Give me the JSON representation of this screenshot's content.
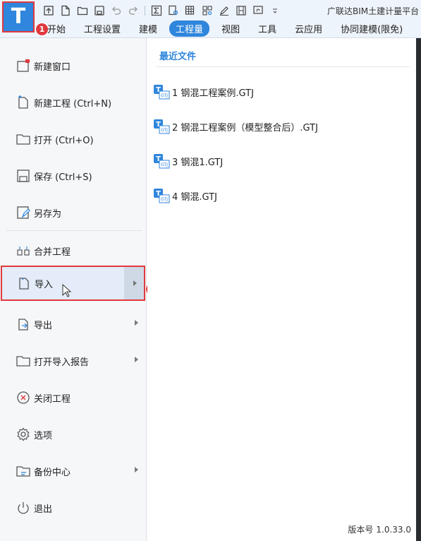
{
  "app": {
    "title": "广联达BIM土建计量平台",
    "logo_letter": "T"
  },
  "badges": {
    "first": "1",
    "second": "2"
  },
  "tabs": [
    {
      "label": "开始",
      "active": false
    },
    {
      "label": "工程设置",
      "active": false
    },
    {
      "label": "建模",
      "active": false
    },
    {
      "label": "工程量",
      "active": true
    },
    {
      "label": "视图",
      "active": false
    },
    {
      "label": "工具",
      "active": false
    },
    {
      "label": "云应用",
      "active": false
    },
    {
      "label": "协同建模(限免)",
      "active": false
    }
  ],
  "menu": {
    "new_window": "新建窗口",
    "new_project": "新建工程 (Ctrl+N)",
    "open": "打开 (Ctrl+O)",
    "save": "保存 (Ctrl+S)",
    "save_as": "另存为",
    "merge": "合并工程",
    "import": "导入",
    "export": "导出",
    "open_import_report": "打开导入报告",
    "close_project": "关闭工程",
    "options": "选项",
    "backup_center": "备份中心",
    "exit": "退出"
  },
  "recent": {
    "title": "最近文件",
    "files": [
      {
        "label": "1 钢混工程案例.GTJ"
      },
      {
        "label": "2 钢混工程案例（模型整合后）.GTJ"
      },
      {
        "label": "3 钢混1.GTJ"
      },
      {
        "label": "4 钢混.GTJ"
      }
    ]
  },
  "version": {
    "label": "版本号",
    "number": "1.0.33.0"
  },
  "colors": {
    "accent": "#2f86dc",
    "highlight": "#e0393e"
  }
}
